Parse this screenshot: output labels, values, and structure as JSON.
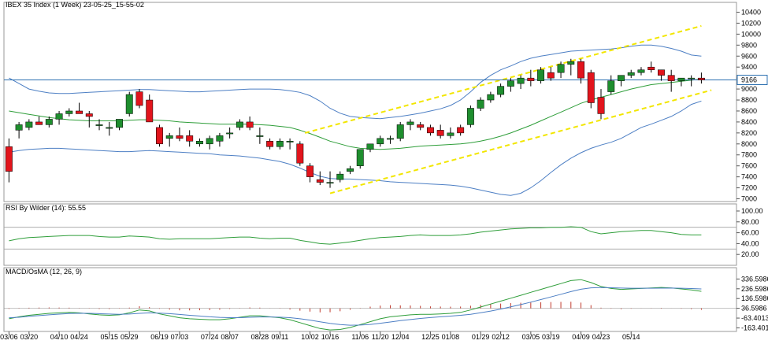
{
  "chart_data": [
    {
      "type": "candlestick",
      "title": "IBEX 35 Index (1 Week) 23-05-25_15-55-02",
      "ylim": [
        6950,
        10450
      ],
      "yticks": [
        7000,
        7200,
        7400,
        7600,
        7800,
        8000,
        8200,
        8400,
        8600,
        8800,
        9000,
        9200,
        9400,
        9600,
        9800,
        10000,
        10200,
        10400
      ],
      "ytick_labels": [
        "7000",
        "7200",
        "7400",
        "7600",
        "7800",
        "8000",
        "8200",
        "8400",
        "8600",
        "8800",
        "9000",
        "9200",
        "9400",
        "9600",
        "9800",
        "10000",
        "10200",
        "10400"
      ],
      "last_price": 9166,
      "last_price_label": "9166",
      "price_line": 9166,
      "candles": [
        {
          "o": 7950,
          "h": 8100,
          "l": 7300,
          "c": 7500
        },
        {
          "o": 8250,
          "h": 8400,
          "l": 8100,
          "c": 8350
        },
        {
          "o": 8300,
          "h": 8450,
          "l": 8250,
          "c": 8400
        },
        {
          "o": 8400,
          "h": 8500,
          "l": 8350,
          "c": 8350
        },
        {
          "o": 8350,
          "h": 8500,
          "l": 8300,
          "c": 8450
        },
        {
          "o": 8450,
          "h": 8600,
          "l": 8350,
          "c": 8550
        },
        {
          "o": 8550,
          "h": 8650,
          "l": 8500,
          "c": 8600
        },
        {
          "o": 8600,
          "h": 8750,
          "l": 8550,
          "c": 8550
        },
        {
          "o": 8550,
          "h": 8600,
          "l": 8300,
          "c": 8500
        },
        {
          "o": 8350,
          "h": 8450,
          "l": 8250,
          "c": 8350
        },
        {
          "o": 8300,
          "h": 8400,
          "l": 8150,
          "c": 8300
        },
        {
          "o": 8300,
          "h": 8450,
          "l": 8250,
          "c": 8450
        },
        {
          "o": 8550,
          "h": 8950,
          "l": 8500,
          "c": 8900
        },
        {
          "o": 8950,
          "h": 9000,
          "l": 8650,
          "c": 8700
        },
        {
          "o": 8800,
          "h": 8900,
          "l": 8400,
          "c": 8400
        },
        {
          "o": 8300,
          "h": 8350,
          "l": 7950,
          "c": 8000
        },
        {
          "o": 8100,
          "h": 8200,
          "l": 7950,
          "c": 8150
        },
        {
          "o": 8150,
          "h": 8300,
          "l": 8050,
          "c": 8100
        },
        {
          "o": 8150,
          "h": 8250,
          "l": 7950,
          "c": 8050
        },
        {
          "o": 8000,
          "h": 8100,
          "l": 7950,
          "c": 8050
        },
        {
          "o": 8000,
          "h": 8150,
          "l": 7900,
          "c": 8100
        },
        {
          "o": 8050,
          "h": 8200,
          "l": 7950,
          "c": 8150
        },
        {
          "o": 8200,
          "h": 8300,
          "l": 8100,
          "c": 8200
        },
        {
          "o": 8300,
          "h": 8450,
          "l": 8250,
          "c": 8400
        },
        {
          "o": 8400,
          "h": 8500,
          "l": 8250,
          "c": 8300
        },
        {
          "o": 8150,
          "h": 8300,
          "l": 8000,
          "c": 8150
        },
        {
          "o": 8050,
          "h": 8100,
          "l": 7900,
          "c": 7950
        },
        {
          "o": 7950,
          "h": 8100,
          "l": 7900,
          "c": 8050
        },
        {
          "o": 8050,
          "h": 8100,
          "l": 7900,
          "c": 8050
        },
        {
          "o": 8000,
          "h": 8050,
          "l": 7600,
          "c": 7650
        },
        {
          "o": 7600,
          "h": 7650,
          "l": 7300,
          "c": 7400
        },
        {
          "o": 7350,
          "h": 7500,
          "l": 7250,
          "c": 7300
        },
        {
          "o": 7300,
          "h": 7500,
          "l": 7200,
          "c": 7300
        },
        {
          "o": 7350,
          "h": 7500,
          "l": 7300,
          "c": 7450
        },
        {
          "o": 7500,
          "h": 7600,
          "l": 7450,
          "c": 7550
        },
        {
          "o": 7600,
          "h": 7900,
          "l": 7550,
          "c": 7900
        },
        {
          "o": 7900,
          "h": 8000,
          "l": 7850,
          "c": 8000
        },
        {
          "o": 8000,
          "h": 8150,
          "l": 7950,
          "c": 8100
        },
        {
          "o": 8100,
          "h": 8150,
          "l": 8000,
          "c": 8100
        },
        {
          "o": 8100,
          "h": 8400,
          "l": 8050,
          "c": 8350
        },
        {
          "o": 8350,
          "h": 8450,
          "l": 8250,
          "c": 8400
        },
        {
          "o": 8350,
          "h": 8400,
          "l": 8250,
          "c": 8300
        },
        {
          "o": 8300,
          "h": 8350,
          "l": 8150,
          "c": 8200
        },
        {
          "o": 8250,
          "h": 8350,
          "l": 8100,
          "c": 8150
        },
        {
          "o": 8150,
          "h": 8300,
          "l": 8100,
          "c": 8200
        },
        {
          "o": 8300,
          "h": 8350,
          "l": 8150,
          "c": 8200
        },
        {
          "o": 8350,
          "h": 8700,
          "l": 8300,
          "c": 8650
        },
        {
          "o": 8650,
          "h": 8850,
          "l": 8600,
          "c": 8800
        },
        {
          "o": 8800,
          "h": 8950,
          "l": 8750,
          "c": 8900
        },
        {
          "o": 8900,
          "h": 9100,
          "l": 8850,
          "c": 9050
        },
        {
          "o": 9050,
          "h": 9200,
          "l": 8950,
          "c": 9150
        },
        {
          "o": 9100,
          "h": 9250,
          "l": 9000,
          "c": 9200
        },
        {
          "o": 9200,
          "h": 9350,
          "l": 9050,
          "c": 9150
        },
        {
          "o": 9150,
          "h": 9400,
          "l": 9100,
          "c": 9350
        },
        {
          "o": 9300,
          "h": 9400,
          "l": 9150,
          "c": 9200
        },
        {
          "o": 9300,
          "h": 9500,
          "l": 9200,
          "c": 9450
        },
        {
          "o": 9450,
          "h": 9550,
          "l": 9250,
          "c": 9500
        },
        {
          "o": 9500,
          "h": 9550,
          "l": 9100,
          "c": 9200
        },
        {
          "o": 9300,
          "h": 9350,
          "l": 8650,
          "c": 8750
        },
        {
          "o": 8850,
          "h": 9000,
          "l": 8450,
          "c": 8550
        },
        {
          "o": 8950,
          "h": 9250,
          "l": 8900,
          "c": 9150
        },
        {
          "o": 9150,
          "h": 9250,
          "l": 9050,
          "c": 9250
        },
        {
          "o": 9250,
          "h": 9350,
          "l": 9200,
          "c": 9300
        },
        {
          "o": 9300,
          "h": 9400,
          "l": 9250,
          "c": 9350
        },
        {
          "o": 9400,
          "h": 9500,
          "l": 9300,
          "c": 9350
        },
        {
          "o": 9350,
          "h": 9350,
          "l": 9150,
          "c": 9250
        },
        {
          "o": 9250,
          "h": 9350,
          "l": 8950,
          "c": 9150
        },
        {
          "o": 9150,
          "h": 9200,
          "l": 9050,
          "c": 9200
        },
        {
          "o": 9200,
          "h": 9250,
          "l": 9050,
          "c": 9200
        },
        {
          "o": 9200,
          "h": 9300,
          "l": 9100,
          "c": 9166
        }
      ],
      "bollinger_upper": [
        9200,
        9100,
        9000,
        8960,
        8930,
        8920,
        8920,
        8930,
        8940,
        8950,
        8960,
        8970,
        8980,
        8990,
        8990,
        8980,
        8970,
        8960,
        8950,
        8950,
        8960,
        8970,
        8980,
        8990,
        9000,
        9000,
        9000,
        8990,
        8970,
        8940,
        8880,
        8780,
        8650,
        8560,
        8500,
        8480,
        8470,
        8460,
        8480,
        8500,
        8530,
        8560,
        8600,
        8640,
        8700,
        8800,
        8950,
        9120,
        9250,
        9350,
        9420,
        9500,
        9560,
        9600,
        9630,
        9660,
        9690,
        9700,
        9710,
        9720,
        9730,
        9750,
        9780,
        9800,
        9800,
        9780,
        9740,
        9690,
        9620,
        9600
      ],
      "bollinger_middle": [
        8600,
        8570,
        8540,
        8510,
        8480,
        8460,
        8440,
        8430,
        8420,
        8420,
        8420,
        8420,
        8430,
        8440,
        8440,
        8430,
        8420,
        8400,
        8390,
        8380,
        8370,
        8360,
        8360,
        8360,
        8360,
        8350,
        8340,
        8320,
        8300,
        8250,
        8190,
        8120,
        8050,
        8000,
        7950,
        7920,
        7910,
        7900,
        7910,
        7920,
        7940,
        7960,
        7970,
        7980,
        7990,
        8000,
        8020,
        8050,
        8090,
        8140,
        8200,
        8270,
        8340,
        8420,
        8500,
        8580,
        8660,
        8740,
        8800,
        8850,
        8900,
        8950,
        9000,
        9040,
        9080,
        9100,
        9120,
        9140,
        9160,
        9180
      ],
      "bollinger_lower": [
        7850,
        7880,
        7900,
        7910,
        7920,
        7920,
        7910,
        7900,
        7890,
        7880,
        7870,
        7860,
        7860,
        7870,
        7880,
        7870,
        7860,
        7850,
        7840,
        7830,
        7820,
        7800,
        7790,
        7780,
        7760,
        7740,
        7710,
        7680,
        7630,
        7560,
        7480,
        7410,
        7370,
        7360,
        7360,
        7350,
        7340,
        7330,
        7310,
        7300,
        7290,
        7280,
        7270,
        7260,
        7250,
        7230,
        7200,
        7160,
        7120,
        7080,
        7060,
        7100,
        7200,
        7330,
        7480,
        7620,
        7740,
        7840,
        7920,
        7980,
        8030,
        8100,
        8200,
        8300,
        8360,
        8430,
        8500,
        8600,
        8720,
        8780
      ],
      "channel_upper": {
        "start": [
          29.5,
          8200
        ],
        "end": [
          69,
          10150
        ]
      },
      "channel_lower": {
        "start": [
          32,
          7100
        ],
        "end": [
          70,
          8980
        ]
      },
      "xtick_labels": [
        "03/06",
        "03/20",
        "04/10",
        "04/24",
        "05/15",
        "05/29",
        "06/19",
        "07/03",
        "07/24",
        "08/07",
        "08/28",
        "09/11",
        "10/02",
        "10/16",
        "11/06",
        "11/20",
        "12/04",
        "12/25",
        "01/08",
        "01/29",
        "02/12",
        "03/05",
        "03/19",
        "04/09",
        "04/23",
        "05/14"
      ],
      "xtick_index": [
        0,
        2,
        5,
        7,
        10,
        12,
        15,
        17,
        20,
        22,
        25,
        27,
        30,
        32,
        35,
        37,
        39,
        42,
        44,
        47,
        49,
        52,
        54,
        57,
        59,
        62
      ]
    },
    {
      "type": "line",
      "title": "RSI By Wilder (14): 55.55",
      "ylim": [
        0,
        100
      ],
      "yticks": [
        20,
        40,
        60,
        80,
        100
      ],
      "ytick_labels": [
        "20.00",
        "40.00",
        "60.00",
        "80.00",
        "100.00"
      ],
      "levels": [
        30,
        70
      ],
      "series": [
        {
          "values": [
            45,
            49,
            51,
            52,
            53,
            54,
            55,
            55,
            55,
            53,
            52,
            52,
            54,
            53,
            52,
            49,
            48,
            49,
            49,
            49,
            49,
            50,
            51,
            52,
            52,
            50,
            49,
            50,
            50,
            46,
            43,
            40,
            39,
            41,
            43,
            46,
            49,
            51,
            52,
            53,
            55,
            56,
            55,
            55,
            55,
            56,
            58,
            61,
            63,
            65,
            67,
            68,
            69,
            69,
            70,
            70,
            71,
            70,
            62,
            58,
            60,
            62,
            63,
            64,
            64,
            62,
            60,
            57,
            56,
            56
          ]
        }
      ]
    },
    {
      "type": "line",
      "title": "MACD/OsMA (12, 26, 9)",
      "ylim": [
        -200,
        380
      ],
      "yticks": [
        -163.4013,
        -63.4013,
        36.5987,
        136.5987,
        236.5987,
        336.5987
      ],
      "ytick_labels": [
        "-163.4013",
        "-63.4013",
        "36.5986",
        "136.5986",
        "236.5986",
        "336.5986"
      ],
      "series": [
        {
          "values": [
            -70,
            -50,
            -35,
            -25,
            -15,
            -10,
            -5,
            -10,
            -20,
            -30,
            -35,
            -30,
            -10,
            20,
            10,
            -20,
            -40,
            -60,
            -70,
            -75,
            -80,
            -80,
            -70,
            -55,
            -40,
            -40,
            -50,
            -60,
            -80,
            -110,
            -140,
            -170,
            -185,
            -180,
            -160,
            -130,
            -100,
            -70,
            -50,
            -40,
            -30,
            -25,
            -25,
            -20,
            -15,
            -5,
            20,
            50,
            80,
            110,
            140,
            170,
            200,
            230,
            260,
            290,
            320,
            330,
            300,
            260,
            240,
            230,
            235,
            240,
            245,
            250,
            245,
            235,
            225,
            210
          ]
        },
        {
          "values": [
            -60,
            -55,
            -45,
            -38,
            -30,
            -23,
            -16,
            -14,
            -15,
            -18,
            -22,
            -24,
            -22,
            -15,
            -10,
            -12,
            -18,
            -26,
            -35,
            -42,
            -50,
            -56,
            -59,
            -59,
            -55,
            -52,
            -52,
            -54,
            -59,
            -70,
            -84,
            -101,
            -118,
            -130,
            -136,
            -135,
            -128,
            -116,
            -103,
            -90,
            -78,
            -67,
            -58,
            -50,
            -43,
            -35,
            -24,
            -9,
            9,
            29,
            51,
            75,
            100,
            126,
            153,
            180,
            208,
            232,
            246,
            249,
            247,
            244,
            242,
            242,
            242,
            243,
            244,
            242,
            239,
            235
          ]
        }
      ],
      "histogram": [
        -10,
        5,
        10,
        13,
        15,
        13,
        11,
        4,
        -5,
        -12,
        -13,
        -6,
        12,
        35,
        20,
        -8,
        -22,
        -34,
        -35,
        -33,
        -30,
        -24,
        -11,
        4,
        15,
        12,
        2,
        -6,
        -21,
        -40,
        -56,
        -69,
        -67,
        -50,
        -24,
        5,
        28,
        46,
        53,
        50,
        48,
        42,
        33,
        30,
        28,
        30,
        44,
        59,
        71,
        81,
        89,
        95,
        100,
        104,
        107,
        110,
        112,
        98,
        54,
        11,
        -7,
        -14,
        -7,
        -2,
        3,
        7,
        1,
        -7,
        -14,
        -25
      ]
    }
  ]
}
